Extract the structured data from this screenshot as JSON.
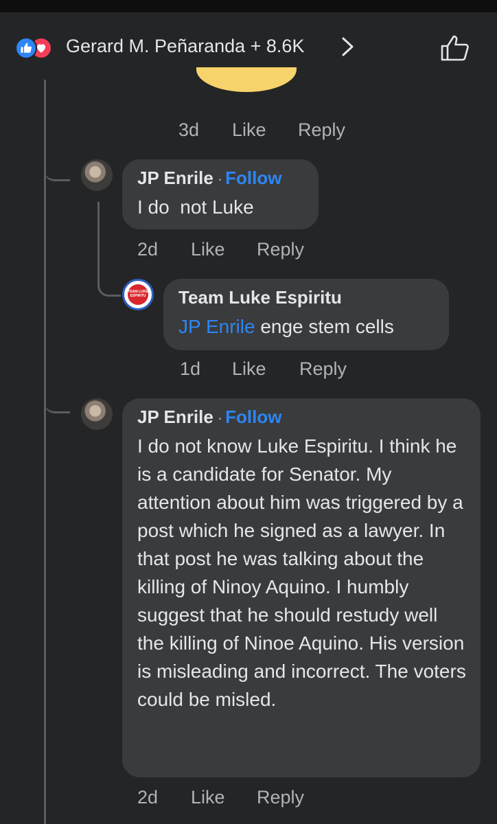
{
  "header": {
    "summary": "Gerard M. Peñaranda + 8.6K",
    "reaction_colors": {
      "like": "#2d86f5",
      "love": "#f33e58"
    }
  },
  "comments": [
    {
      "meta": {
        "time": "3d",
        "like": "Like",
        "reply": "Reply"
      }
    },
    {
      "author": "JP Enrile",
      "separator": "·",
      "follow": "Follow",
      "text": "I do  not Luke",
      "meta": {
        "time": "2d",
        "like": "Like",
        "reply": "Reply"
      }
    },
    {
      "author": "Team Luke Espiritu",
      "mention": "JP Enrile",
      "text": " enge stem cells",
      "avatar_logo_text": "TEAM LUKE ESPIRITU",
      "meta": {
        "time": "1d",
        "like": "Like",
        "reply": "Reply"
      }
    },
    {
      "author": "JP Enrile",
      "separator": "·",
      "follow": "Follow",
      "text": "I do not know Luke Espiritu. I think he is a candidate for Senator. My attention about him was triggered by a post which he signed as a lawyer. In that post he was talking about the killing of Ninoy Aquino. I humbly suggest that he should  restudy well the killing of Ninoe Aquino. His version is misleading and incorrect. The voters could be misled.",
      "meta": {
        "time": "2d",
        "like": "Like",
        "reply": "Reply"
      }
    }
  ],
  "icons": {
    "header_like": "thumbs-up-icon",
    "header_love": "heart-icon",
    "chevron": "chevron-right-icon",
    "react_button": "thumbs-up-outline-icon"
  }
}
